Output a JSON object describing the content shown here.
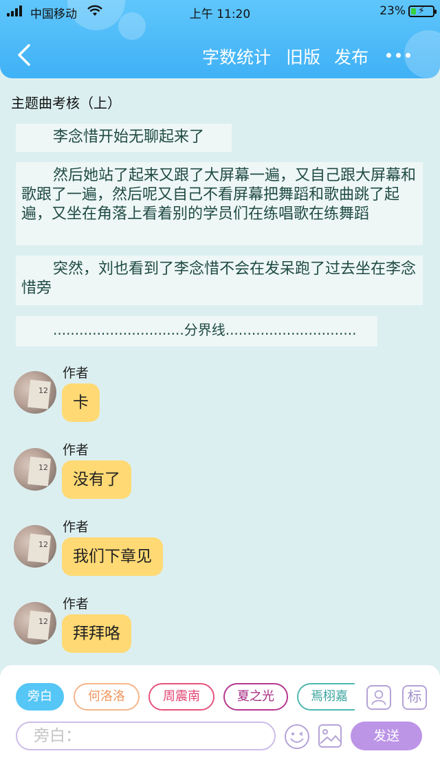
{
  "status_bar": {
    "carrier": "中国移动",
    "time": "上午 11:20",
    "battery": "23%",
    "battery_level": 0.23
  },
  "nav": {
    "back_icon": "chevron-left-icon",
    "word_count": "字数统计",
    "old_version": "旧版",
    "publish": "发布",
    "more_icon": "more-dots-icon"
  },
  "chapter": {
    "title": "主题曲考核（上）"
  },
  "narration": [
    "李念惜开始无聊起来了",
    "然后她站了起来又跟了大屏幕一遍，又自己跟大屏幕和歌跟了一遍，然后呢又自己不看屏幕把舞蹈和歌曲跳了起遍，又坐在角落上看着别的学员们在练唱歌在练舞蹈",
    "突然，刘也看到了李念惜不会在发呆跑了过去坐在李念惜旁",
    "..............................分界线.............................."
  ],
  "messages": [
    {
      "author": "作者",
      "text": "卡"
    },
    {
      "author": "作者",
      "text": "没有了"
    },
    {
      "author": "作者",
      "text": "我们下章见"
    },
    {
      "author": "作者",
      "text": "拜拜咯"
    }
  ],
  "panel": {
    "roles": [
      "旁白",
      "何洛洛",
      "周震南",
      "夏之光",
      "焉栩嘉"
    ],
    "mark_button": "标",
    "input_placeholder": "旁白：",
    "send_label": "发送"
  },
  "colors": {
    "header": "#3fb1f6",
    "page_bg": "#dceff0",
    "bubble": "#ffd974",
    "send": "#bc95e6"
  }
}
